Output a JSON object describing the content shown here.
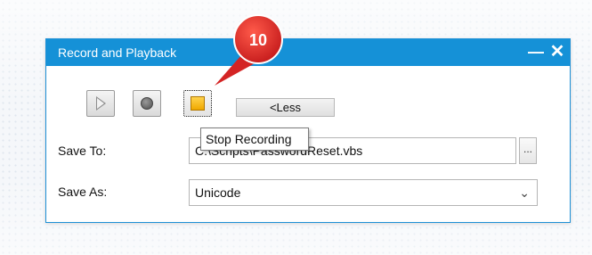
{
  "window": {
    "title": "Record and Playback",
    "minimize_glyph": "—",
    "close_glyph": "✕"
  },
  "toolbar": {
    "play_icon": "play-icon",
    "record_icon": "record-icon",
    "stop_icon": "stop-icon",
    "less_label": "<Less"
  },
  "tooltip": {
    "text": "Stop Recording"
  },
  "form": {
    "save_to_label": "Save To:",
    "save_to_value": "C:\\Scripts\\PasswordReset.vbs",
    "browse_label": "...",
    "save_as_label": "Save As:",
    "save_as_value": "Unicode"
  },
  "callout": {
    "number": "10",
    "color": "#e02020"
  },
  "colors": {
    "titlebar": "#1591d7",
    "stop_square": "#f7b500"
  }
}
